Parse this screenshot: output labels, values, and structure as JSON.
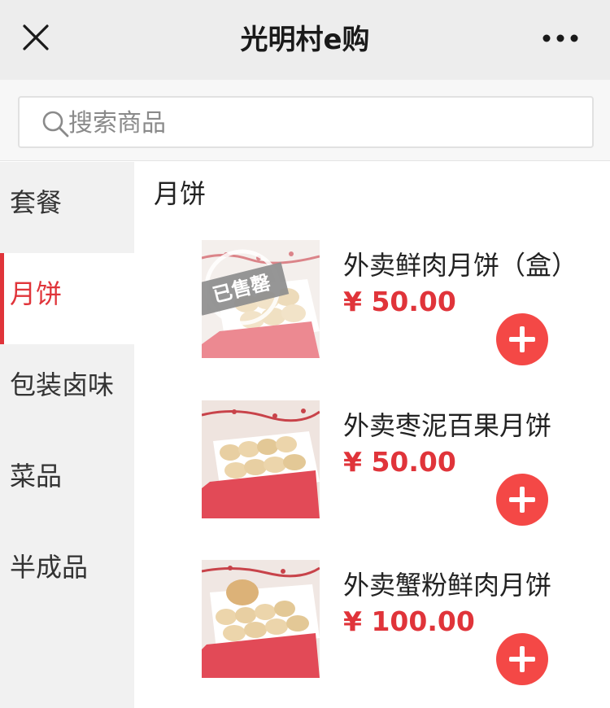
{
  "header": {
    "title": "光明村e购",
    "close_icon": "close-icon",
    "more_icon": "more-icon"
  },
  "search": {
    "placeholder": "搜索商品",
    "value": ""
  },
  "sidebar": {
    "active_index": 1,
    "items": [
      {
        "label": "套餐"
      },
      {
        "label": "月饼"
      },
      {
        "label": "包装卤味"
      },
      {
        "label": "菜品"
      },
      {
        "label": "半成品"
      }
    ]
  },
  "main": {
    "section_title": "月饼",
    "products": [
      {
        "name": "外卖鲜肉月饼（盒）",
        "price": "¥ 50.00",
        "sold_out": true,
        "sold_out_label": "已售罄"
      },
      {
        "name": "外卖枣泥百果月饼",
        "price": "¥ 50.00",
        "sold_out": false
      },
      {
        "name": "外卖蟹粉鲜肉月饼",
        "price": "¥ 100.00",
        "sold_out": false
      }
    ]
  },
  "colors": {
    "accent": "#e0343a",
    "add_button": "#f44846",
    "topbar": "#ededed",
    "sidebar": "#f1f1f1"
  }
}
